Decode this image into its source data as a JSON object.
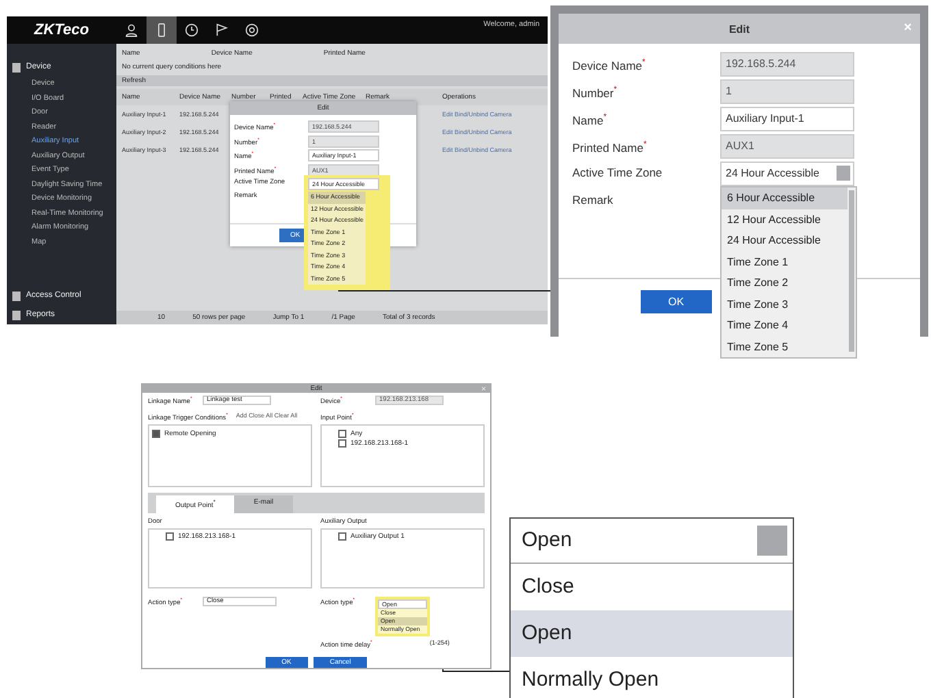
{
  "overview": {
    "logo": "ZKTeco",
    "nav_tabs": [
      {
        "selected": false
      },
      {
        "selected": true
      },
      {
        "selected": false
      },
      {
        "selected": false
      },
      {
        "selected": false
      }
    ],
    "welcome": "Welcome, admin",
    "sidebar": [
      {
        "kind": "module",
        "label": "Device",
        "selected": false
      },
      {
        "kind": "item",
        "label": "Device",
        "selected": false
      },
      {
        "kind": "item",
        "label": "I/O Board",
        "selected": false
      },
      {
        "kind": "item",
        "label": "Door",
        "selected": false
      },
      {
        "kind": "item",
        "label": "Reader",
        "selected": false
      },
      {
        "kind": "item",
        "label": "Auxiliary Input",
        "selected": true
      },
      {
        "kind": "item",
        "label": "Auxiliary Output",
        "selected": false
      },
      {
        "kind": "item",
        "label": "Event Type",
        "selected": false
      },
      {
        "kind": "item",
        "label": "Daylight Saving Time",
        "selected": false
      },
      {
        "kind": "item",
        "label": "Device Monitoring",
        "selected": false
      },
      {
        "kind": "item",
        "label": "Real-Time Monitoring",
        "selected": false
      },
      {
        "kind": "item",
        "label": "Alarm Monitoring",
        "selected": false
      },
      {
        "kind": "item",
        "label": "Map",
        "selected": false
      },
      {
        "kind": "module",
        "label": "Access Control",
        "selected": false
      },
      {
        "kind": "module",
        "label": "Reports",
        "selected": false
      }
    ],
    "filters": [
      "Name",
      "Device Name",
      "Printed Name"
    ],
    "query_note": "No current query conditions here",
    "refresh": "Refresh",
    "columns": [
      "Name",
      "Device Name",
      "Number",
      "Printed",
      "Active Time Zone",
      "Remark",
      "Operations"
    ],
    "rows": [
      {
        "name": "Auxiliary Input-1",
        "device": "192.168.5.244",
        "operations": "Edit  Bind/Unbind Camera"
      },
      {
        "name": "Auxiliary Input-2",
        "device": "192.168.5.244",
        "operations": "Edit  Bind/Unbind Camera"
      },
      {
        "name": "Auxiliary Input-3",
        "device": "192.168.5.244",
        "operations": "Edit  Bind/Unbind Camera"
      }
    ],
    "pager": [
      "10",
      "50 rows per page",
      "Jump To 1",
      "/1 Page",
      "Total of 3 records"
    ],
    "dialog": {
      "title": "Edit",
      "fields": [
        {
          "kind": "readonly",
          "label": "Device Name$^{*}$",
          "value": "192.168.5.244"
        },
        {
          "kind": "readonly",
          "label": "Number$^{*}$",
          "value": "1"
        },
        {
          "kind": "input",
          "label": "Name$^{*}$",
          "value": "Auxiliary Input-1"
        },
        {
          "kind": "readonly",
          "label": "Printed Name$^{*}$",
          "value": "AUX1"
        },
        {
          "kind": "select",
          "label": "Active Time Zone",
          "value": "24 Hour Accessible"
        },
        {
          "kind": "text",
          "label": "Remark"
        }
      ],
      "options": [
        {
          "label": "6 Hour Accessible",
          "selected": true
        },
        {
          "label": "12 Hour Accessible",
          "selected": false
        },
        {
          "label": "24 Hour Accessible",
          "selected": false
        },
        {
          "label": "Time Zone 1",
          "selected": false
        },
        {
          "label": "Time Zone 2",
          "selected": false
        },
        {
          "label": "Time Zone 3",
          "selected": false
        },
        {
          "label": "Time Zone 4",
          "selected": false
        },
        {
          "label": "Time Zone 5",
          "selected": false
        }
      ],
      "ok": "OK"
    }
  },
  "edit_zoom": {
    "title": "Edit",
    "close": "×",
    "fields": [
      {
        "kind": "readonly",
        "label": "Device Name$^{*}$",
        "value": "192.168.5.244"
      },
      {
        "kind": "readonly",
        "label": "Number$^{*}$",
        "value": "1"
      },
      {
        "kind": "input",
        "label": "Name$^{*}$",
        "value": "Auxiliary Input-1"
      },
      {
        "kind": "readonly",
        "label": "Printed Name$^{*}$",
        "value": "AUX1"
      },
      {
        "kind": "select",
        "label": "Active Time Zone",
        "value": "24 Hour Accessible"
      },
      {
        "kind": "text",
        "label": "Remark"
      }
    ],
    "options": [
      {
        "label": "6 Hour Accessible",
        "selected": true
      },
      {
        "label": "12 Hour Accessible",
        "selected": false
      },
      {
        "label": "24 Hour Accessible",
        "selected": false
      },
      {
        "label": "Time Zone 1",
        "selected": false
      },
      {
        "label": "Time Zone 2",
        "selected": false
      },
      {
        "label": "Time Zone 3",
        "selected": false
      },
      {
        "label": "Time Zone 4",
        "selected": false
      },
      {
        "label": "Time Zone 5",
        "selected": false
      }
    ],
    "ok": "OK"
  },
  "linkage": {
    "title": "Edit",
    "close": "×",
    "name_label": "Linkage Name$^{*}$",
    "name_value": "Linkage test",
    "device_label": "Device$^{*}$",
    "device_value": "192.168.213.168",
    "trigger_label": "Linkage Trigger Conditions$^{*}$",
    "trigger_actions": "Add  Close All  Clear All",
    "triggers": [
      {
        "label": "Remote Opening",
        "checked": true
      }
    ],
    "input_label": "Input Point$^{*}$",
    "inputs": [
      {
        "label": "Any",
        "checked": false
      },
      {
        "label": "192.168.213.168-1",
        "checked": false
      }
    ],
    "tabs": [
      {
        "label": "Output Point$^{*}$",
        "selected": true
      },
      {
        "label": "E-mail",
        "selected": false
      }
    ],
    "door_label": "Door",
    "doors": [
      {
        "label": "192.168.213.168-1",
        "checked": false
      }
    ],
    "aux_label": "Auxiliary Output",
    "aux": [
      {
        "label": "Auxiliary Output 1",
        "checked": false
      }
    ],
    "left_action_label": "Action type$^{*}$",
    "left_action_value": "Close",
    "right_action_label": "Action type$^{*}$",
    "right_action_value": "Open",
    "delay_label": "Action time delay$^{*}$",
    "delay_hint": "(1-254)",
    "options": [
      {
        "label": "Close",
        "selected": false
      },
      {
        "label": "Open",
        "selected": true
      },
      {
        "label": "Normally Open",
        "selected": false
      }
    ],
    "ok": "OK",
    "cancel": "Cancel"
  },
  "dropdown_zoom": {
    "value": "Open",
    "options": [
      {
        "label": "Close",
        "selected": false
      },
      {
        "label": "Open",
        "selected": true
      },
      {
        "label": "Normally Open",
        "selected": false
      }
    ]
  }
}
